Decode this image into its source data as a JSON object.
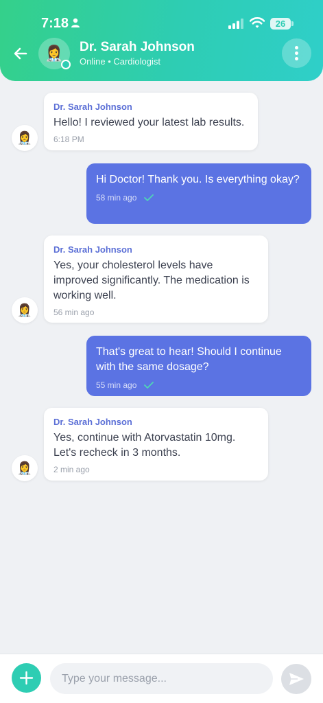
{
  "status_bar": {
    "time": "7:18",
    "battery": "26"
  },
  "header": {
    "name": "Dr. Sarah Johnson",
    "subtitle": "Online • Cardiologist",
    "avatar_emoji": "👩‍⚕️"
  },
  "messages": [
    {
      "direction": "incoming",
      "sender": "Dr. Sarah Johnson",
      "text": "Hello! I reviewed your latest lab results.",
      "time": "6:18 PM"
    },
    {
      "direction": "outgoing",
      "text": "Hi Doctor! Thank you. Is everything okay?",
      "time": "58 min ago",
      "read": true
    },
    {
      "direction": "incoming",
      "sender": "Dr. Sarah Johnson",
      "text": "Yes, your cholesterol levels have improved significantly. The medication is working well.",
      "time": "56 min ago"
    },
    {
      "direction": "outgoing",
      "text": "That's great to hear! Should I continue with the same dosage?",
      "time": "55 min ago",
      "read": true
    },
    {
      "direction": "incoming",
      "sender": "Dr. Sarah Johnson",
      "text": "Yes, continue with Atorvastatin 10mg. Let's recheck in 3 months.",
      "time": "2 min ago"
    }
  ],
  "composer": {
    "placeholder": "Type your message..."
  },
  "colors": {
    "accent": "#2ecdb3",
    "outgoing_bubble": "#5b73e3",
    "sender_name": "#5b6fd6"
  }
}
